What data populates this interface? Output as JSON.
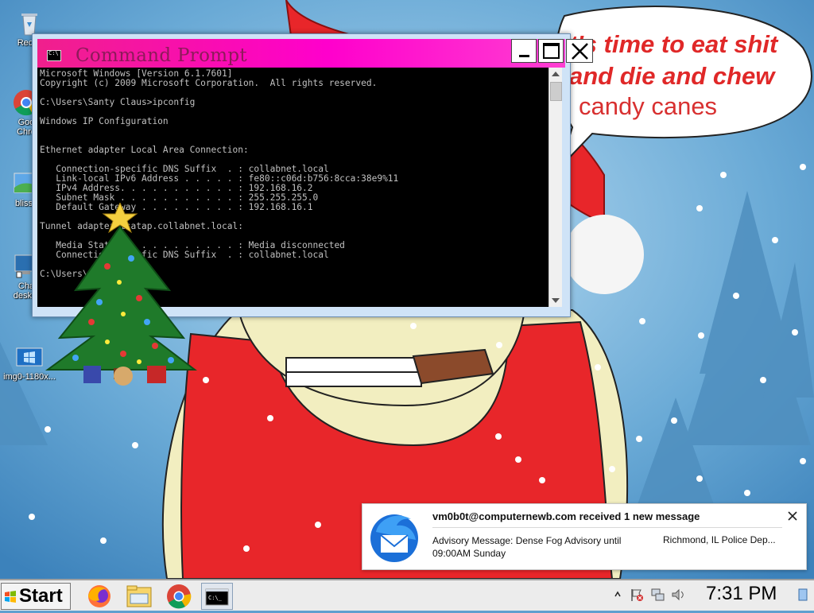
{
  "desktop": {
    "icons": [
      {
        "label": "Recyc",
        "icon": "recycle-bin-icon"
      },
      {
        "label": "Goo\nChro",
        "icon": "chrome-shortcut-icon"
      },
      {
        "label": "blissh",
        "icon": "image-file-icon"
      },
      {
        "label": "Cha\ndeskto",
        "icon": "desktop-shortcut-icon"
      },
      {
        "label": "img0-1180x...",
        "icon": "image-file-icon"
      }
    ],
    "speech_bubble": {
      "line1": "t's time to eat shit",
      "line2": "and die and chew",
      "line3": "candy canes"
    }
  },
  "cmd_window": {
    "title": "Command Prompt",
    "console_lines": [
      "Microsoft Windows [Version 6.1.7601]",
      "Copyright (c) 2009 Microsoft Corporation.  All rights reserved.",
      "",
      "C:\\Users\\Santy Claus>ipconfig",
      "",
      "Windows IP Configuration",
      "",
      "",
      "Ethernet adapter Local Area Connection:",
      "",
      "   Connection-specific DNS Suffix  . : collabnet.local",
      "   Link-local IPv6 Address . . . . . : fe80::c06d:b756:8cca:38e9%11",
      "   IPv4 Address. . . . . . . . . . . : 192.168.16.2",
      "   Subnet Mask . . . . . . . . . . . : 255.255.255.0",
      "   Default Gateway . . . . . . . . . : 192.168.16.1",
      "",
      "Tunnel adapter isatap.collabnet.local:",
      "",
      "   Media State . . . . . . . . . . . : Media disconnected",
      "   Connection-specific DNS Suffix  . : collabnet.local",
      "",
      "C:\\Users\\Santy Claus>"
    ]
  },
  "notification": {
    "title": "vm0b0t@computernewb.com received 1 new message",
    "body": "Advisory Message: Dense Fog Advisory until 09:00AM Sunday",
    "sender": "Richmond, IL Police Dep...",
    "icon": "thunderbird-icon"
  },
  "taskbar": {
    "start_label": "Start",
    "apps": [
      "firefox-icon",
      "file-explorer-icon",
      "chrome-icon",
      "command-prompt-icon"
    ],
    "tray": [
      "show-hidden-icons-chevron",
      "action-center-flag-icon",
      "network-icon",
      "volume-icon"
    ],
    "clock": "7:31 PM"
  },
  "colors": {
    "titlebar": "#ff00cc",
    "console_bg": "#000000",
    "console_fg": "#c0c0c0",
    "wallpaper_sky": "#5f9fcf",
    "santa_red": "#e8262a"
  }
}
